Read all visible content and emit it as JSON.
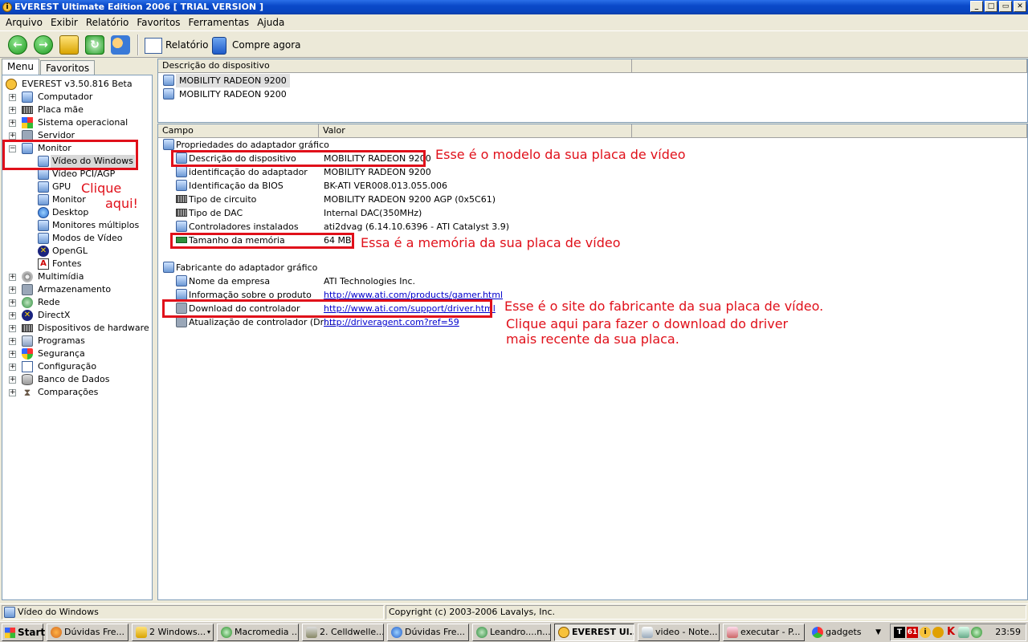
{
  "window": {
    "title": "EVEREST Ultimate Edition 2006  [ TRIAL VERSION ]",
    "controls": [
      "_",
      "□",
      "▭",
      "✕"
    ]
  },
  "menubar": [
    "Arquivo",
    "Exibir",
    "Relatório",
    "Favoritos",
    "Ferramentas",
    "Ajuda"
  ],
  "toolbar": {
    "report_label": "Relatório",
    "buy_label": "Compre agora"
  },
  "tabs": {
    "menu": "Menu",
    "favorites": "Favoritos"
  },
  "tree": {
    "root": "EVEREST v3.50.816 Beta",
    "items": [
      "Computador",
      "Placa mãe",
      "Sistema operacional",
      "Servidor",
      "Monitor"
    ],
    "monitor_children": [
      "Vídeo do Windows",
      "Vídeo PCI/AGP",
      "GPU",
      "Monitor",
      "Desktop",
      "Monitores múltiplos",
      "Modos de Vídeo",
      "OpenGL",
      "Fontes"
    ],
    "items_after": [
      "Multimídia",
      "Armazenamento",
      "Rede",
      "DirectX",
      "Dispositivos de hardware",
      "Programas",
      "Segurança",
      "Configuração",
      "Banco de Dados",
      "Comparações"
    ]
  },
  "device_list": {
    "header": "Descrição do dispositivo",
    "rows": [
      "MOBILITY RADEON 9200",
      "MOBILITY RADEON 9200"
    ]
  },
  "details": {
    "headers": {
      "field": "Campo",
      "value": "Valor"
    },
    "section1": "Propriedades do adaptador gráfico",
    "rows1": [
      {
        "field": "Descrição do dispositivo",
        "value": "MOBILITY RADEON 9200"
      },
      {
        "field": "identificação do adaptador",
        "value": "MOBILITY RADEON 9200"
      },
      {
        "field": "Identificação da BIOS",
        "value": "BK-ATI VER008.013.055.006"
      },
      {
        "field": "Tipo de circuito",
        "value": "MOBILITY RADEON 9200 AGP (0x5C61)"
      },
      {
        "field": "Tipo de DAC",
        "value": "Internal DAC(350MHz)"
      },
      {
        "field": "Controladores instalados",
        "value": "ati2dvag (6.14.10.6396 - ATI Catalyst 3.9)"
      },
      {
        "field": "Tamanho da memória",
        "value": "64 MB"
      }
    ],
    "section2": "Fabricante do adaptador gráfico",
    "rows2": [
      {
        "field": "Nome da empresa",
        "value": "ATI Technologies Inc."
      },
      {
        "field": "Informação sobre o produto",
        "value": "http://www.ati.com/products/gamer.html"
      },
      {
        "field": "Download do controlador",
        "value": "http://www.ati.com/support/driver.html"
      },
      {
        "field": "Atualização de controlador (Dri...",
        "value": "http://driveragent.com?ref=59"
      }
    ]
  },
  "annotations": {
    "click_1": "Clique",
    "click_2": "aqui!",
    "model": "Esse é o modelo da sua placa de vídeo",
    "memory": "Essa é a memória da sua placa de vídeo",
    "site": "Esse é o site do fabricante da sua placa de vídeo.",
    "download_1": "Clique aqui para fazer o download do driver",
    "download_2": "mais recente da sua placa."
  },
  "statusbar": {
    "left": "Vídeo do Windows",
    "right": "Copyright (c) 2003-2006 Lavalys, Inc."
  },
  "taskbar": {
    "start": "Start",
    "tasks": [
      "Dúvidas Fre...",
      "2 Windows...",
      "Macromedia ...",
      "2. Celldwelle...",
      "Dúvidas Fre...",
      "Leandro....n...",
      "EVEREST Ul...",
      "video - Note...",
      "executar - P...",
      "gadgets"
    ],
    "tray_badge": "61",
    "clock": "23:59"
  },
  "colors": {
    "annotation": "#e0101a",
    "titlebar": "#0a49c9",
    "link": "#0000cc"
  }
}
